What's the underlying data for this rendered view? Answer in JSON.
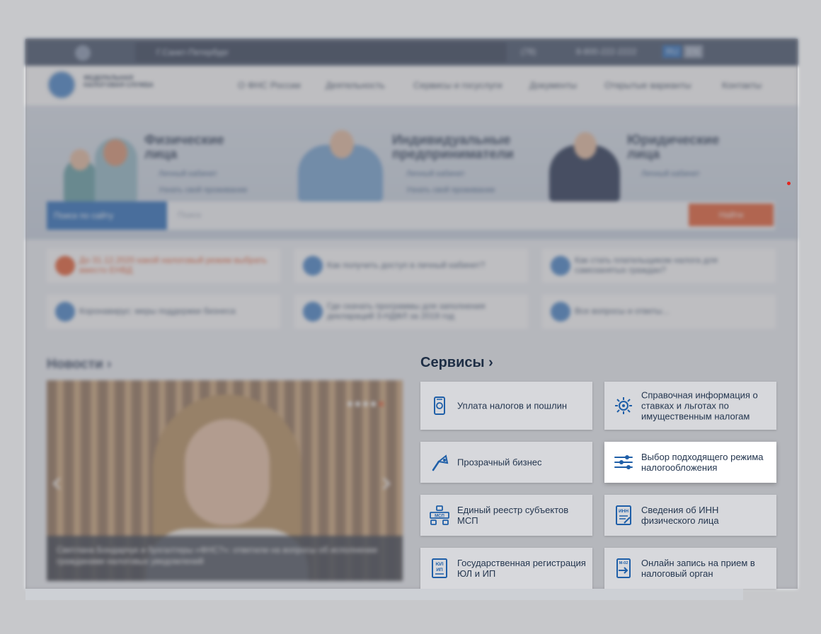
{
  "topbar": {
    "city": "Г.Санкт-Петербург",
    "region_code": "(78)",
    "phone": "8-800-222-2222",
    "lang_ru": "RU",
    "lang_en": "EN"
  },
  "header": {
    "logo_text": "ФЕДЕРАЛЬНАЯ НАЛОГОВАЯ СЛУЖБА",
    "nav": [
      "О ФНС России",
      "Деятельность",
      "Сервисы и госуслуги",
      "Документы",
      "Открытые варианты",
      "Контакты"
    ]
  },
  "categories": [
    {
      "title": "Физические лица",
      "link1": "Личный кабинет",
      "link2": "Узнать свой проживание"
    },
    {
      "title": "Индивидуальные предприниматели",
      "link1": "Личный кабинет",
      "link2": "Узнать свой проживание"
    },
    {
      "title": "Юридические лица",
      "link1": "Личный кабинет"
    }
  ],
  "search": {
    "scope": "Поиск по сайту",
    "placeholder": "Поиск",
    "button": "Найти"
  },
  "quick_links": [
    "До 31.12.2020 какой налоговый режим выбрать вместо ЕНВД",
    "Как получить доступ в личный кабинет?",
    "Как стать плательщиком налога для самозанятых граждан?",
    "Коронавирус: меры поддержки бизнеса",
    "Где скачать программы для заполнения деклараций 3-НДФЛ за 2019 год",
    "Все вопросы и ответы..."
  ],
  "news": {
    "title": "Новости ›",
    "caption": "Светлана Бондарчук и бухгалтеры «ФНС?»: ответили на вопросы об исполнении гражданами налоговых уведомлений"
  },
  "services": {
    "title": "Сервисы ›",
    "items": [
      {
        "label": "Уплата налогов и пошлин",
        "icon": "payment-icon"
      },
      {
        "label": "Справочная информация о ставках и льготах по имущественным налогам",
        "icon": "reference-info-icon"
      },
      {
        "label": "Прозрачный бизнес",
        "icon": "transparent-business-icon"
      },
      {
        "label": "Выбор подходящего режима налогообложения",
        "icon": "sliders-icon"
      },
      {
        "label": "Единый реестр субъектов МСП",
        "icon": "msp-registry-icon"
      },
      {
        "label": "Сведения об ИНН физического лица",
        "icon": "inn-document-icon"
      },
      {
        "label": "Государственная регистрация ЮЛ и ИП",
        "icon": "registration-document-icon"
      },
      {
        "label": "Онлайн запись на прием в налоговый орган",
        "icon": "appointment-icon"
      }
    ]
  }
}
